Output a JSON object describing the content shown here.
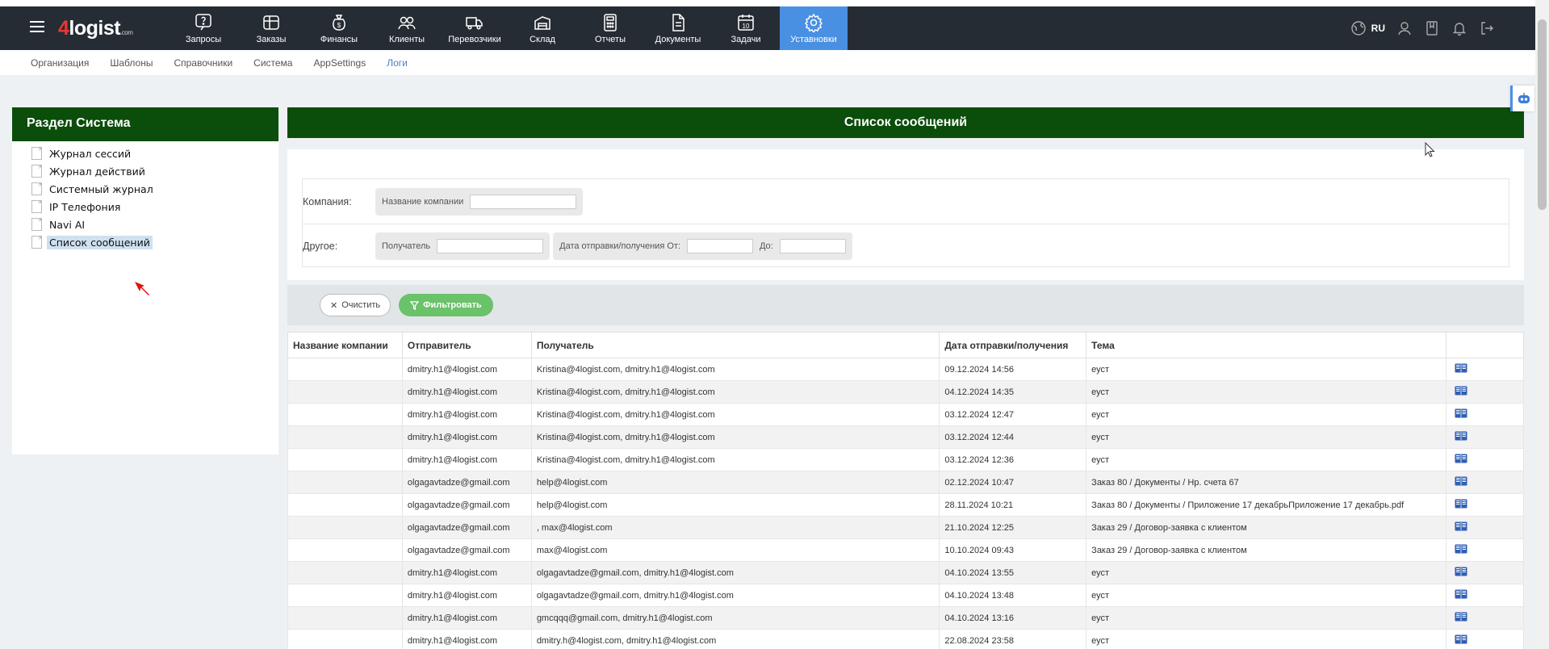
{
  "app": {
    "logo_main": "logist",
    "logo_four": "4",
    "logo_com": ".com"
  },
  "nav": {
    "items": [
      {
        "label": "Запросы",
        "icon": "question-chat-icon"
      },
      {
        "label": "Заказы",
        "icon": "box-icon"
      },
      {
        "label": "Финансы",
        "icon": "money-bag-icon"
      },
      {
        "label": "Клиенты",
        "icon": "users-icon"
      },
      {
        "label": "Перевозчики",
        "icon": "truck-icon"
      },
      {
        "label": "Склад",
        "icon": "warehouse-icon"
      },
      {
        "label": "Отчеты",
        "icon": "calculator-icon"
      },
      {
        "label": "Документы",
        "icon": "document-icon"
      },
      {
        "label": "Задачи",
        "icon": "calendar-icon"
      },
      {
        "label": "Уставновки",
        "icon": "gear-icon"
      }
    ],
    "active_index": 9,
    "lang": "RU"
  },
  "subnav": {
    "items": [
      "Организация",
      "Шаблоны",
      "Справочники",
      "Система",
      "AppSettings",
      "Логи"
    ],
    "active_index": 5
  },
  "sidebar": {
    "title": "Раздел Система",
    "items": [
      "Журнал сессий",
      "Журнал действий",
      "Системный журнал",
      "IP Телефония",
      "Navi AI",
      "Список сообщений"
    ],
    "active_index": 5
  },
  "main": {
    "title": "Список сообщений"
  },
  "filters": {
    "company_label": "Компания:",
    "company_name_label": "Название компании",
    "company_name_value": "",
    "other_label": "Другое:",
    "recipient_label": "Получатель",
    "recipient_value": "",
    "date_from_label": "Дата отправки/получения От:",
    "date_from_value": "",
    "date_to_label": "До:",
    "date_to_value": "",
    "clear_label": "Очистить",
    "filter_label": "Фильтровать"
  },
  "table": {
    "headers": [
      "Название компании",
      "Отправитель",
      "Получатель",
      "Дата отправки/получения",
      "Тема",
      ""
    ],
    "rows": [
      [
        "",
        "dmitry.h1@4logist.com",
        "Kristina@4logist.com, dmitry.h1@4logist.com",
        "09.12.2024 14:56",
        "еуст"
      ],
      [
        "",
        "dmitry.h1@4logist.com",
        "Kristina@4logist.com, dmitry.h1@4logist.com",
        "04.12.2024 14:35",
        "еуст"
      ],
      [
        "",
        "dmitry.h1@4logist.com",
        "Kristina@4logist.com, dmitry.h1@4logist.com",
        "03.12.2024 12:47",
        "еуст"
      ],
      [
        "",
        "dmitry.h1@4logist.com",
        "Kristina@4logist.com, dmitry.h1@4logist.com",
        "03.12.2024 12:44",
        "еуст"
      ],
      [
        "",
        "dmitry.h1@4logist.com",
        "Kristina@4logist.com, dmitry.h1@4logist.com",
        "03.12.2024 12:36",
        "еуст"
      ],
      [
        "",
        "olgagavtadze@gmail.com",
        "help@4logist.com",
        "02.12.2024 10:47",
        "Заказ 80 / Документы / Нр. счета 67"
      ],
      [
        "",
        "olgagavtadze@gmail.com",
        "help@4logist.com",
        "28.11.2024 10:21",
        "Заказ 80 / Документы / Приложение 17 декабрьПриложение 17 декабрь.pdf"
      ],
      [
        "",
        "olgagavtadze@gmail.com",
        ", max@4logist.com",
        "21.10.2024 12:25",
        "Заказ 29 / Договор-заявка с клиентом"
      ],
      [
        "",
        "olgagavtadze@gmail.com",
        "max@4logist.com",
        "10.10.2024 09:43",
        "Заказ 29 / Договор-заявка с клиентом"
      ],
      [
        "",
        "dmitry.h1@4logist.com",
        "olgagavtadze@gmail.com, dmitry.h1@4logist.com",
        "04.10.2024 13:55",
        "еуст"
      ],
      [
        "",
        "dmitry.h1@4logist.com",
        "olgagavtadze@gmail.com, dmitry.h1@4logist.com",
        "04.10.2024 13:48",
        "еуст"
      ],
      [
        "",
        "dmitry.h1@4logist.com",
        "gmcqqq@gmail.com, dmitry.h1@4logist.com",
        "04.10.2024 13:16",
        "еуст"
      ],
      [
        "",
        "dmitry.h1@4logist.com",
        "dmitry.h@4logist.com, dmitry.h1@4logist.com",
        "22.08.2024 23:58",
        "еуст"
      ]
    ]
  },
  "colors": {
    "topbar": "#262c34",
    "active_nav": "#4a90e2",
    "header_green": "#0b4d0b",
    "filter_green": "#6ac26a"
  }
}
